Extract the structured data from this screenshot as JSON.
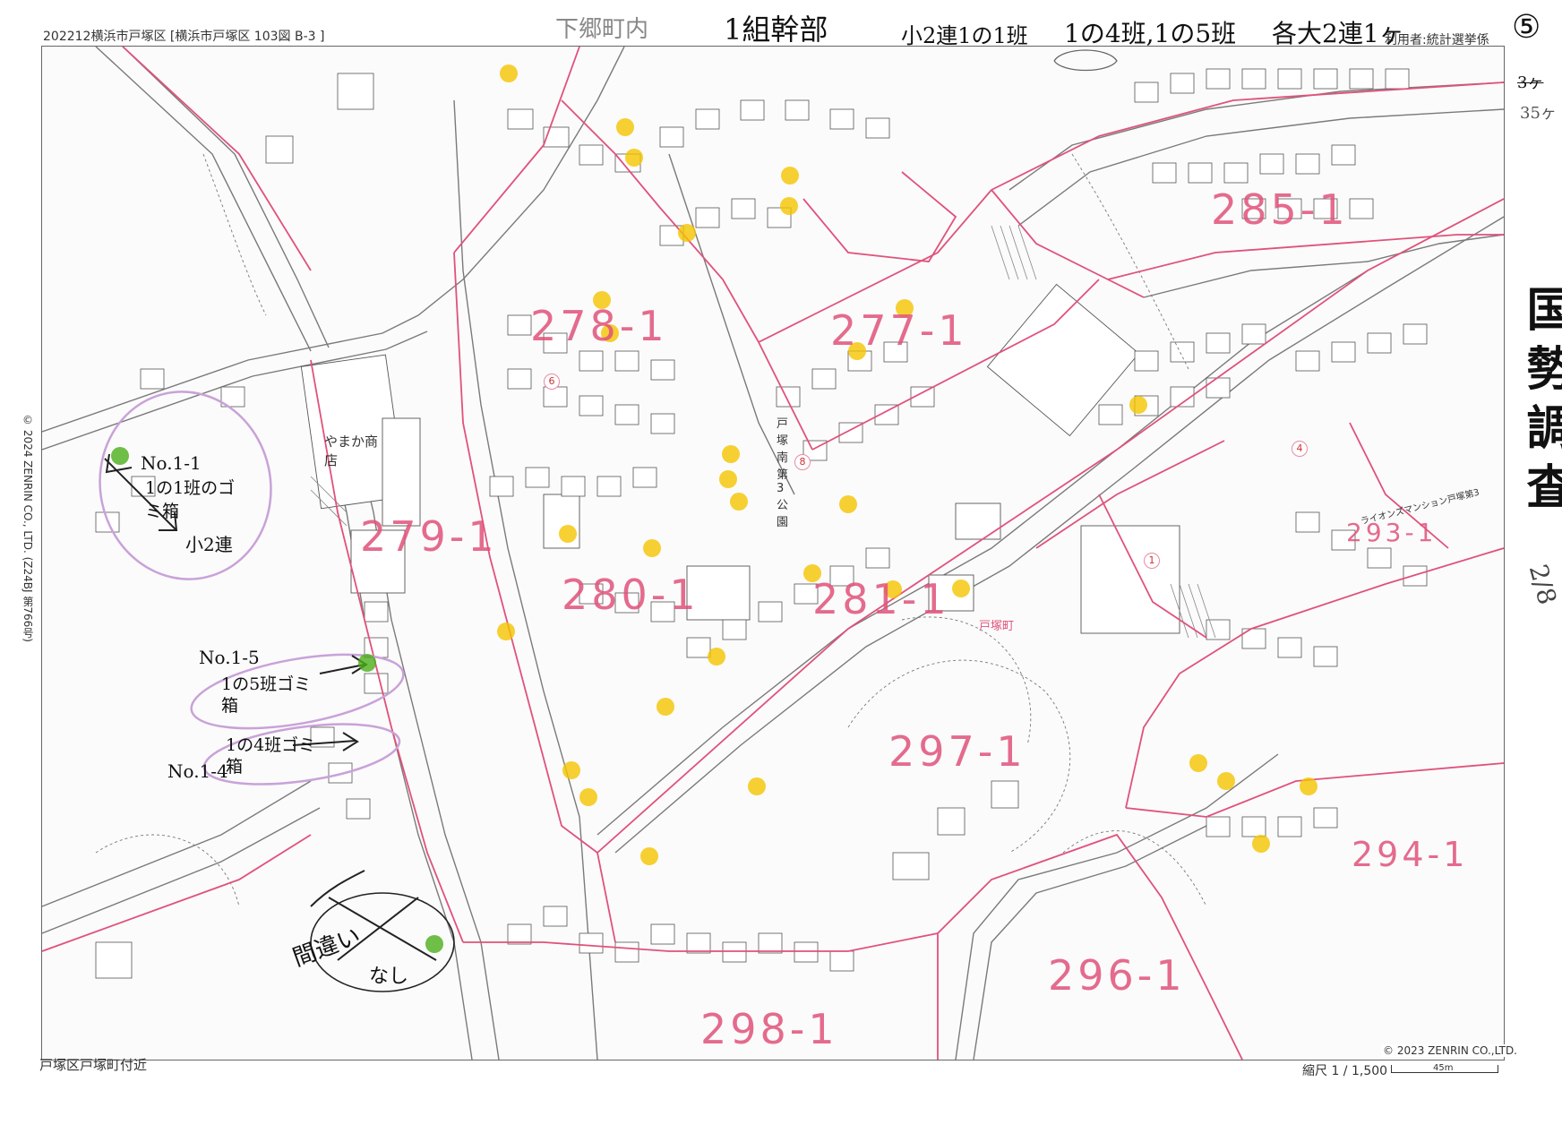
{
  "header": {
    "sheet": "202212横浜市戸塚区 [横浜市戸塚区 103図 B-3 ]",
    "user": "利用者:統計選挙係"
  },
  "footer": {
    "area": "戸塚区戸塚町付近",
    "scale": "縮尺 1 / 1,500",
    "scale_length": "45m",
    "copyright_map": "© 2023 ZENRIN CO.,LTD.",
    "copyright_side": "© 2024 ZENRIN CO., LTD. (Z24BJ 第766号)"
  },
  "annotations": {
    "top_1": "下郷町内",
    "top_2": "1組幹部",
    "top_3": "小2連1の1班",
    "top_4": "1の4班,1の5班",
    "top_5": "各大2連1ヶ",
    "sheet_number": "⑤",
    "count_1": "3ヶ",
    "count_2": "35ヶ",
    "census": "国勢調査",
    "date": "2/8",
    "no_1_1": "No.1-1",
    "group_1_1": "1の1班のゴミ箱",
    "small_2": "小2連",
    "no_1_5": "No.1-5",
    "group_1_5": "1の5班ゴミ箱",
    "group_1_4": "1の4班ゴミ箱",
    "no_1_4": "No.1-4",
    "mistake": "間違い",
    "none": "なし"
  },
  "districts": [
    "278-1",
    "277-1",
    "279-1",
    "280-1",
    "281-1",
    "285-1",
    "293-1",
    "297-1",
    "296-1",
    "298-1",
    "294-1"
  ],
  "places": {
    "store": "やまか商店",
    "park": "戸塚南第3公園",
    "town": "戸塚町",
    "apartment": "ライオンズマンション戸塚第3"
  },
  "colors": {
    "boundary": "#e0527a",
    "marker_yellow": "#f5c400",
    "marker_green": "#4caf1a",
    "highlight_pink": "#c9a2d8"
  }
}
